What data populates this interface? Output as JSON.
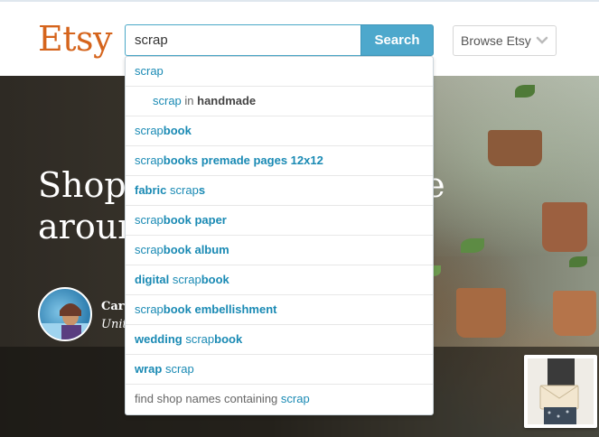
{
  "header": {
    "logo": "Etsy",
    "search": {
      "value": "scrap",
      "button_label": "Search"
    },
    "browse_label": "Browse Etsy"
  },
  "hero": {
    "title_line1": "Shop",
    "title_line1_tail": "le",
    "title_line2": "aroun",
    "seller_name": "Carl",
    "seller_location": "Unit"
  },
  "suggestions": [
    {
      "parts": [
        {
          "t": "scrap",
          "b": false
        }
      ]
    },
    {
      "indent": true,
      "parts": [
        {
          "t": "scrap",
          "b": false
        },
        {
          "t": " in ",
          "style": "plain"
        },
        {
          "t": "handmade",
          "style": "dark"
        }
      ]
    },
    {
      "parts": [
        {
          "t": "scrap",
          "b": false
        },
        {
          "t": "book",
          "b": true
        }
      ]
    },
    {
      "parts": [
        {
          "t": "scrap",
          "b": false
        },
        {
          "t": "books premade pages 12x12",
          "b": true
        }
      ]
    },
    {
      "parts": [
        {
          "t": "fabric ",
          "b": true
        },
        {
          "t": "scrap",
          "b": false
        },
        {
          "t": "s",
          "b": true
        }
      ]
    },
    {
      "parts": [
        {
          "t": "scrap",
          "b": false
        },
        {
          "t": "book paper",
          "b": true
        }
      ]
    },
    {
      "parts": [
        {
          "t": "scrap",
          "b": false
        },
        {
          "t": "book album",
          "b": true
        }
      ]
    },
    {
      "parts": [
        {
          "t": "digital ",
          "b": true
        },
        {
          "t": "scrap",
          "b": false
        },
        {
          "t": "book",
          "b": true
        }
      ]
    },
    {
      "parts": [
        {
          "t": "scrap",
          "b": false
        },
        {
          "t": "book embellishment",
          "b": true
        }
      ]
    },
    {
      "parts": [
        {
          "t": "wedding ",
          "b": true
        },
        {
          "t": "scrap",
          "b": false
        },
        {
          "t": "book",
          "b": true
        }
      ]
    },
    {
      "parts": [
        {
          "t": "wrap ",
          "b": true
        },
        {
          "t": "scrap",
          "b": false
        }
      ]
    },
    {
      "parts": [
        {
          "t": "find shop names containing ",
          "style": "plain"
        },
        {
          "t": "scrap",
          "b": false
        }
      ]
    }
  ],
  "colors": {
    "brand": "#d5641c",
    "accent": "#4da8cc",
    "link": "#1a8ab4"
  },
  "icons": {
    "browse": "chevron-down-icon"
  }
}
